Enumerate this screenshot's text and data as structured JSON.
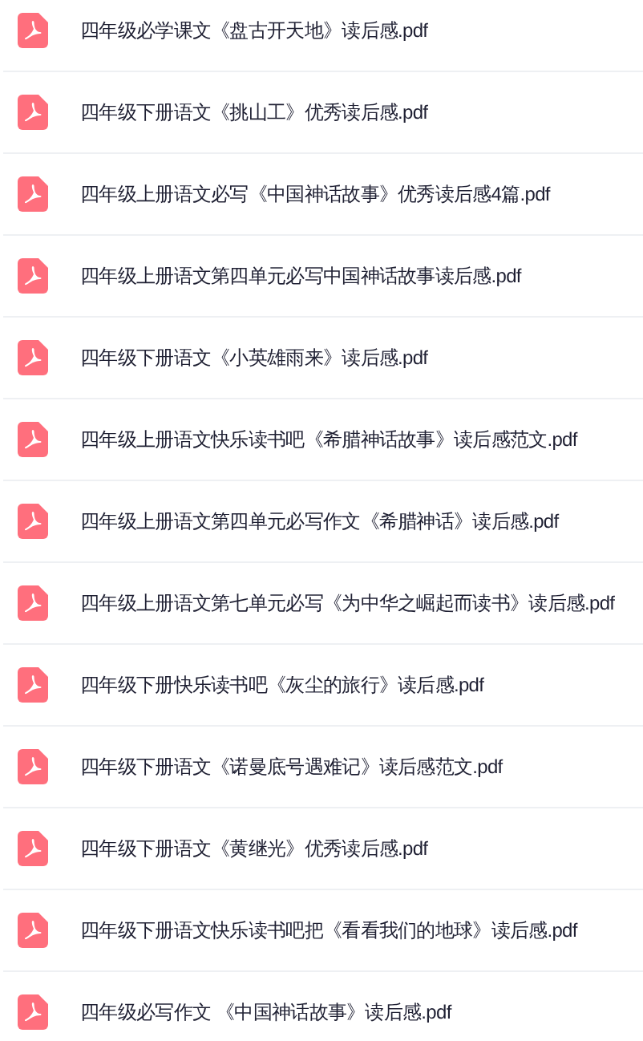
{
  "files": [
    {
      "name": "四年级必学课文《盘古开天地》读后感.pdf"
    },
    {
      "name": "四年级下册语文《挑山工》优秀读后感.pdf"
    },
    {
      "name": "四年级上册语文必写《中国神话故事》优秀读后感4篇.pdf"
    },
    {
      "name": "四年级上册语文第四单元必写中国神话故事读后感.pdf"
    },
    {
      "name": "四年级下册语文《小英雄雨来》读后感.pdf"
    },
    {
      "name": "四年级上册语文快乐读书吧《希腊神话故事》读后感范文.pdf"
    },
    {
      "name": "四年级上册语文第四单元必写作文《希腊神话》读后感.pdf"
    },
    {
      "name": "四年级上册语文第七单元必写《为中华之崛起而读书》读后感.pdf"
    },
    {
      "name": "四年级下册快乐读书吧《灰尘的旅行》读后感.pdf"
    },
    {
      "name": "四年级下册语文《诺曼底号遇难记》读后感范文.pdf"
    },
    {
      "name": "四年级下册语文《黄继光》优秀读后感.pdf"
    },
    {
      "name": "四年级下册语文快乐读书吧把《看看我们的地球》读后感.pdf"
    },
    {
      "name": "四年级必写作文 《中国神话故事》读后感.pdf"
    }
  ]
}
